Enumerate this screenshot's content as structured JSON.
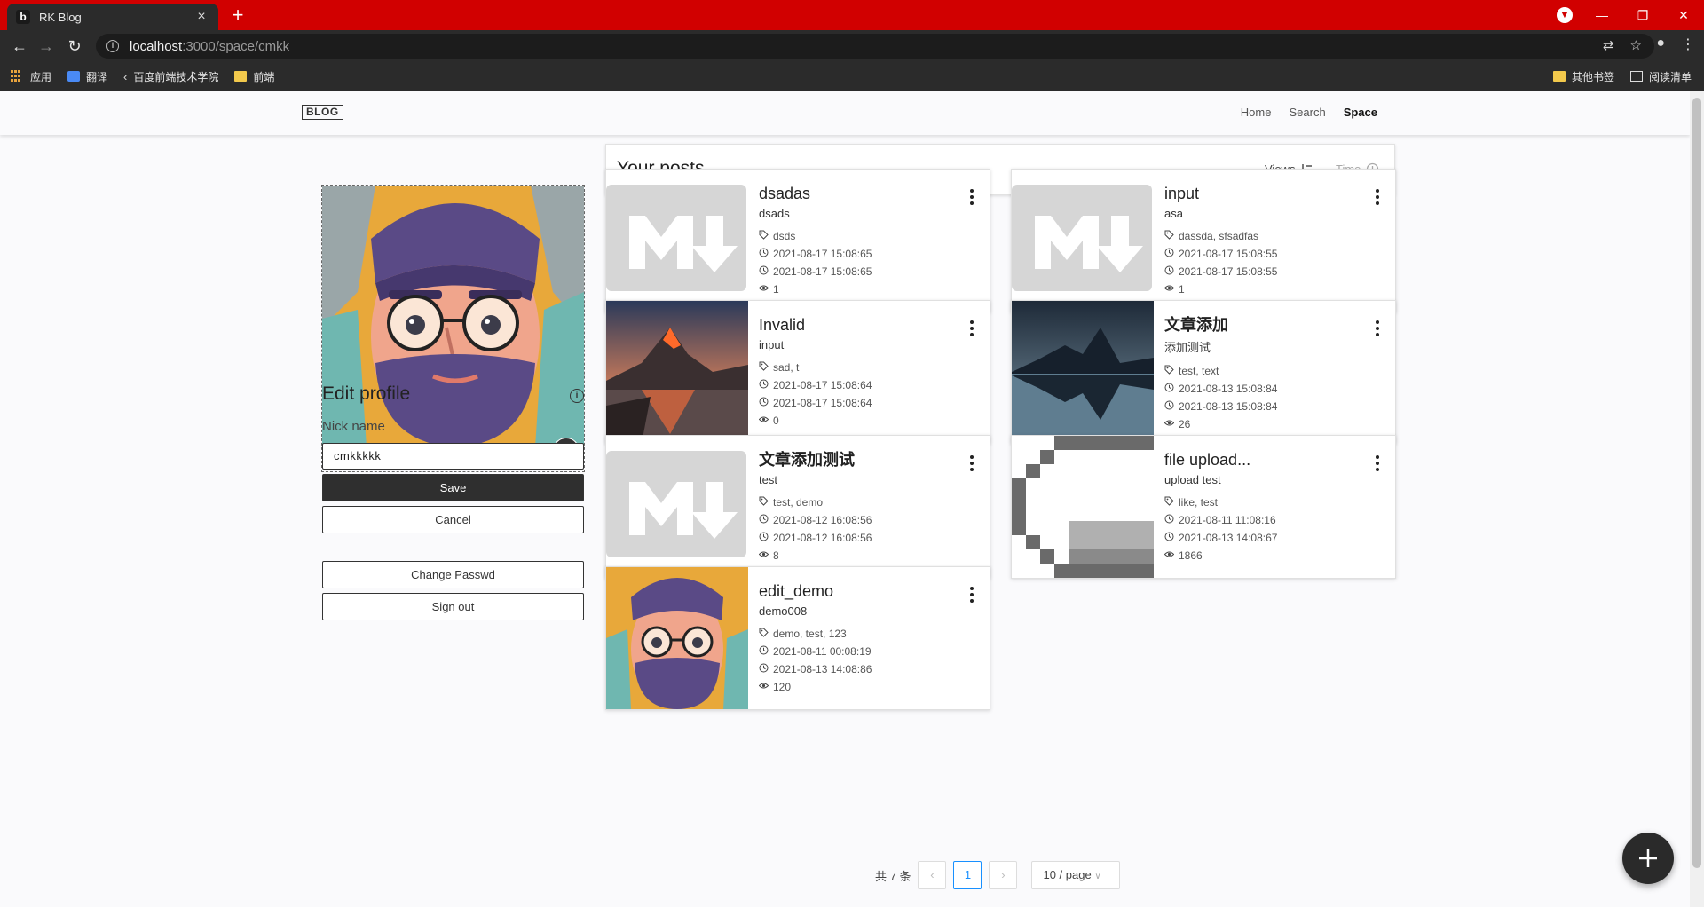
{
  "browser": {
    "tab_title": "RK Blog",
    "url_host": "localhost",
    "url_path": ":3000/space/cmkk",
    "bookmarks": [
      "应用",
      "翻译",
      "百度前端技术学院",
      "前端"
    ],
    "bookmarks_right": [
      "其他书签",
      "阅读清单"
    ]
  },
  "nav": {
    "logo": "BLOG",
    "links": [
      "Home",
      "Search",
      "Space"
    ],
    "active": "Space"
  },
  "profile": {
    "edit_title": "Edit profile",
    "nick_label": "Nick name",
    "nick_value": "cmkkkkk",
    "save": "Save",
    "cancel": "Cancel",
    "change_pass": "Change Passwd",
    "sign_out": "Sign out"
  },
  "posts": {
    "title": "Your posts",
    "sort_views": "Views",
    "sort_time": "Time",
    "items": [
      {
        "title": "dsadas",
        "subtitle": "dsads",
        "tags": "dsds",
        "created": "2021-08-17 15:08:65",
        "updated": "2021-08-17 15:08:65",
        "views": "1",
        "thumb": "markdown"
      },
      {
        "title": "input",
        "subtitle": "asa",
        "tags": "dassda, sfsadfas",
        "created": "2021-08-17 15:08:55",
        "updated": "2021-08-17 15:08:55",
        "views": "1",
        "thumb": "markdown"
      },
      {
        "title": "Invalid",
        "subtitle": "input",
        "tags": "sad, t",
        "created": "2021-08-17 15:08:64",
        "updated": "2021-08-17 15:08:64",
        "views": "0",
        "thumb": "mountain-sunset"
      },
      {
        "title": "文章添加",
        "subtitle": "添加测试",
        "tags": "test, text",
        "created": "2021-08-13 15:08:84",
        "updated": "2021-08-13 15:08:84",
        "views": "26",
        "thumb": "mountain-lake"
      },
      {
        "title": "文章添加测试",
        "subtitle": "test",
        "tags": "test, demo",
        "created": "2021-08-12 16:08:56",
        "updated": "2021-08-12 16:08:56",
        "views": "8",
        "thumb": "markdown"
      },
      {
        "title": "file upload...",
        "subtitle": "upload test",
        "tags": "like, test",
        "created": "2021-08-11 11:08:16",
        "updated": "2021-08-13 14:08:67",
        "views": "1866",
        "thumb": "pixel-logo"
      },
      {
        "title": "edit_demo",
        "subtitle": "demo008",
        "tags": "demo, test, 123",
        "created": "2021-08-11 00:08:19",
        "updated": "2021-08-13 14:08:86",
        "views": "120",
        "thumb": "avatar"
      }
    ]
  },
  "pagination": {
    "total": "共 7 条",
    "current": "1",
    "page_size": "10 / page"
  },
  "colors": {
    "chrome_red": "#d10000",
    "accent_blue": "#1890ff",
    "dark": "#2f2f2f"
  }
}
